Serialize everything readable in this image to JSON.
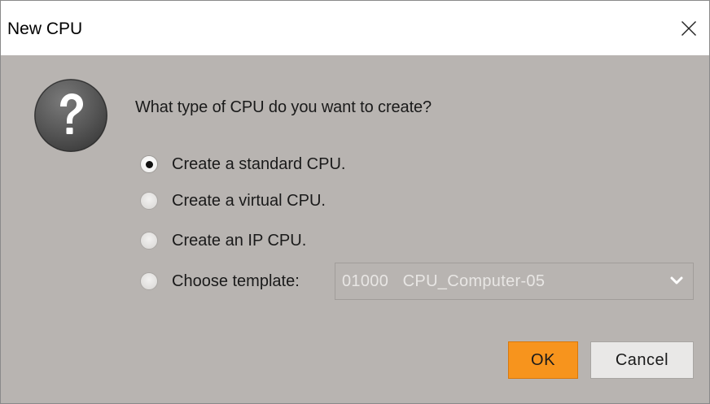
{
  "window": {
    "title": "New CPU",
    "close_icon": "close-icon"
  },
  "dialog": {
    "icon": "question-icon",
    "prompt": "What type of CPU do you want to create?",
    "options": [
      {
        "label": "Create a standard CPU.",
        "checked": true
      },
      {
        "label": "Create a virtual CPU.",
        "checked": false
      },
      {
        "label": "Create an IP CPU.",
        "checked": false
      },
      {
        "label": "Choose template:",
        "checked": false
      }
    ],
    "template_select": {
      "value": "01000   CPU_Computer-05",
      "enabled": false,
      "icon": "chevron-down-icon"
    }
  },
  "buttons": {
    "ok_label": "OK",
    "cancel_label": "Cancel"
  },
  "colors": {
    "background": "#b8b4b1",
    "accent_ok": "#f7941d",
    "titlebar": "#ffffff"
  }
}
